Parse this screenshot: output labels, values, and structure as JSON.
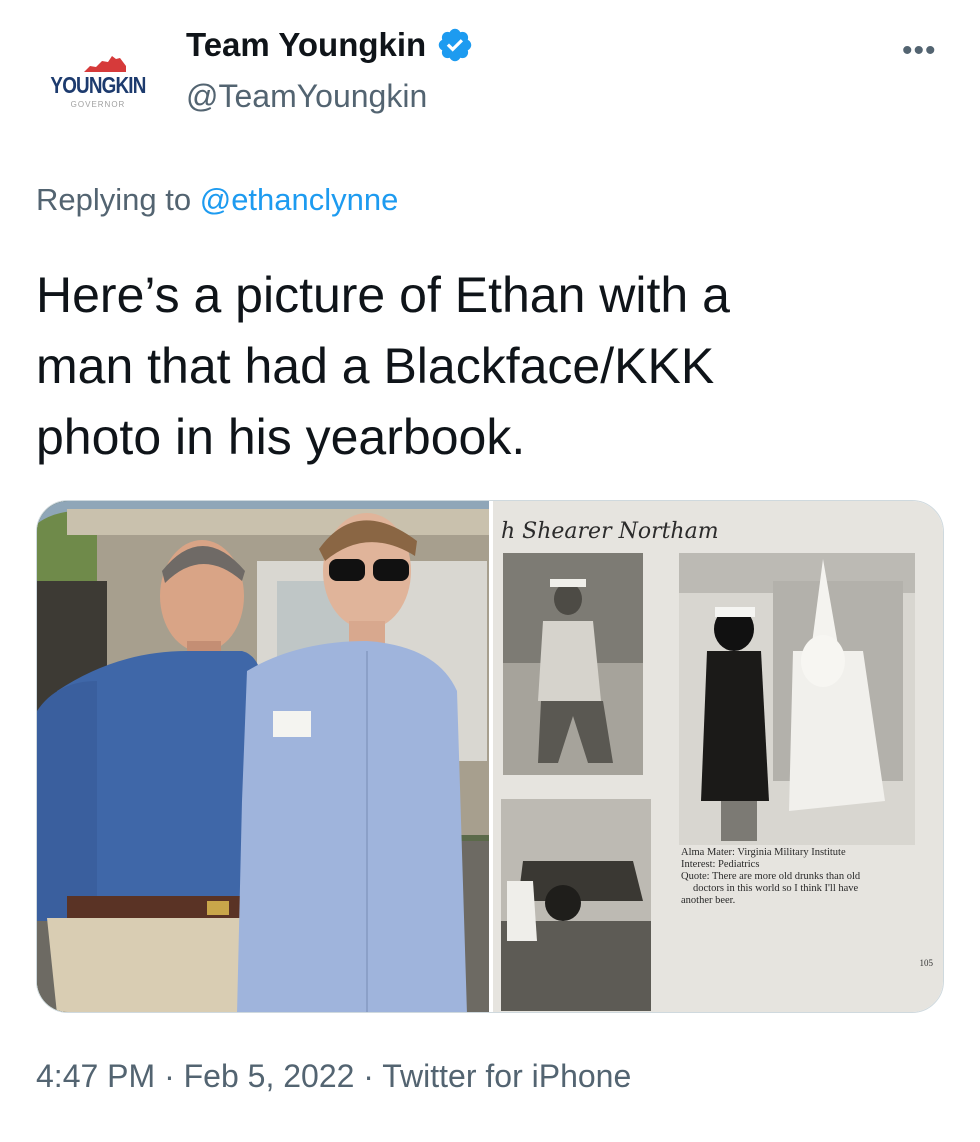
{
  "author": {
    "display_name": "Team Youngkin",
    "handle": "@TeamYoungkin",
    "verified": true,
    "avatar": {
      "logo_text": "YOUNGKIN",
      "logo_subtext": "GOVERNOR"
    }
  },
  "more_label": "•••",
  "reply": {
    "prefix": "Replying to",
    "mention": "@ethanclynne"
  },
  "tweet_text": "Here’s a picture of Ethan with a\nman that had a Blackface/KKK\nphoto in his yearbook.",
  "media": {
    "yearbook": {
      "header": "h Shearer Northam",
      "caption_lines": [
        "Alma Mater: Virginia Military Institute",
        "Interest: Pediatrics",
        "Quote: There are more old drunks than old",
        "doctors in this world so I think I'll have",
        "another beer."
      ],
      "page_number": "105"
    }
  },
  "footer": {
    "time": "4:47 PM",
    "sep1": " · ",
    "date": "Feb 5, 2022",
    "sep2": " · ",
    "source": "Twitter for iPhone"
  },
  "colors": {
    "text": "#0f1419",
    "secondary": "#536471",
    "link": "#1d9bf0",
    "verified": "#1d9bf0",
    "logo_red": "#d63a3a",
    "logo_navy": "#1d3b6e"
  }
}
